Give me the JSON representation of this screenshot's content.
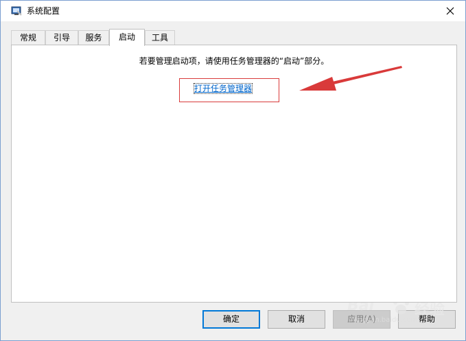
{
  "window": {
    "title": "系统配置"
  },
  "tabs": [
    {
      "label": "常规"
    },
    {
      "label": "引导"
    },
    {
      "label": "服务"
    },
    {
      "label": "启动",
      "active": true
    },
    {
      "label": "工具"
    }
  ],
  "startup": {
    "info": "若要管理启动项，请使用任务管理器的“启动”部分。",
    "link_label": "打开任务管理器"
  },
  "buttons": {
    "ok": "确定",
    "cancel": "取消",
    "apply": "应用(A)",
    "help": "帮助"
  },
  "annotation": {
    "color": "#d93a3a"
  },
  "watermark": {
    "brand": "Bai",
    "brand_cn": "经验",
    "url": "jingyan.baidu.com"
  },
  "colors": {
    "accent": "#0078d7",
    "link": "#0066cc",
    "panel_bg": "#ffffff",
    "dialog_bg": "#f0f0f0"
  }
}
